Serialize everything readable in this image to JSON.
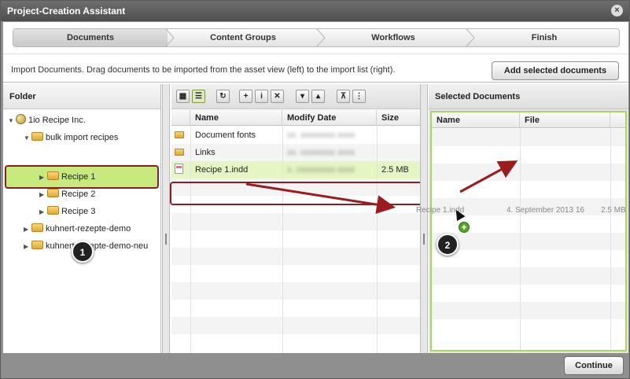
{
  "window": {
    "title": "Project-Creation Assistant"
  },
  "steps": [
    "Documents",
    "Content Groups",
    "Workflows",
    "Finish"
  ],
  "info": {
    "text": "Import Documents. Drag documents to be imported from the asset view (left) to the import list (right).",
    "add_label": "Add selected documents"
  },
  "folder_pane": {
    "header": "Folder",
    "tree": [
      {
        "label": "1io Recipe Inc.",
        "level": 0,
        "expanded": true
      },
      {
        "label": "bulk import recipes",
        "level": 1,
        "expanded": true
      },
      {
        "label": "Recipe 1",
        "level": 2,
        "selected": true
      },
      {
        "label": "Recipe 2",
        "level": 2
      },
      {
        "label": "Recipe 3",
        "level": 2
      },
      {
        "label": "kuhnert-rezepte-demo",
        "level": 1
      },
      {
        "label": "kuhnert-rezepte-demo-neu",
        "level": 1
      }
    ]
  },
  "asset_pane": {
    "toolbar_icons": [
      "thumbnail-view-icon",
      "list-view-icon",
      "refresh-icon",
      "new-document-icon",
      "info-icon",
      "delete-icon",
      "folder-down-icon",
      "folder-up-icon",
      "extract-icon",
      "zip-icon"
    ],
    "columns": [
      "Name",
      "Modify Date",
      "Size"
    ],
    "rows": [
      {
        "name": "Document fonts",
        "type": "folder",
        "date": "",
        "size": ""
      },
      {
        "name": "Links",
        "type": "folder",
        "date": "",
        "size": ""
      },
      {
        "name": "Recipe 1.indd",
        "type": "indd",
        "date": "",
        "size": "2.5 MB"
      }
    ]
  },
  "selected_pane": {
    "header": "Selected Documents",
    "columns": [
      "Name",
      "File"
    ]
  },
  "drag": {
    "name": "Recipe 1.indd",
    "date": "4. September 2013 16",
    "size": "2.5 MB"
  },
  "callouts": [
    "1",
    "2"
  ],
  "footer": {
    "continue_label": "Continue"
  }
}
